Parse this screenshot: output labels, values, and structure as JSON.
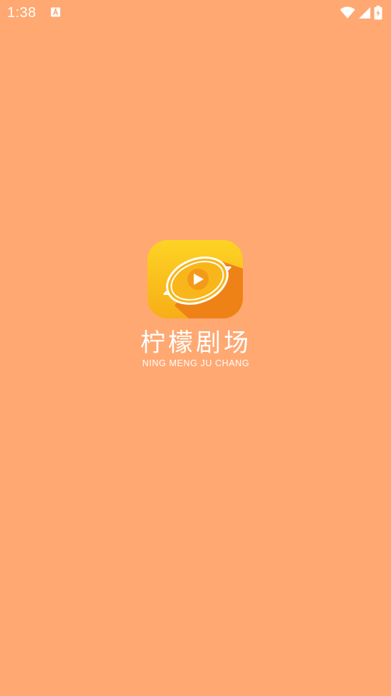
{
  "status_bar": {
    "time": "1:38",
    "notification_icon": "text-a-icon",
    "icons": [
      "wifi-icon",
      "signal-icon",
      "battery-charging-icon"
    ]
  },
  "splash": {
    "logo_icon": "lemon-play-icon",
    "title": "柠檬剧场",
    "subtitle": "NING MENG JU CHANG"
  },
  "colors": {
    "background": "#FFA872",
    "logo_yellow": "#FBC419",
    "logo_orange": "#EE8217",
    "text": "#FFFFFF"
  }
}
